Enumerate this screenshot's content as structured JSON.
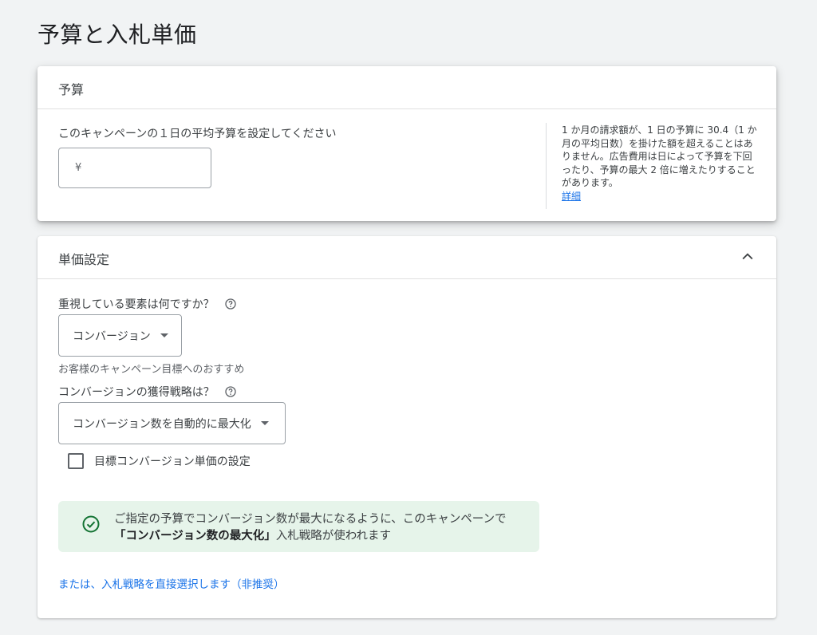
{
  "page": {
    "title": "予算と入札単価"
  },
  "budget": {
    "header": "予算",
    "question": "このキャンペーンの１日の平均予算を設定してください",
    "currency_symbol": "¥",
    "value": "",
    "help_text": "1 か月の請求額が、1 日の予算に 30.4（1 か月の平均日数）を掛けた額を超えることはありません。広告費用は日によって予算を下回ったり、予算の最大 2 倍に増えたりすることがあります。",
    "help_link": "詳細"
  },
  "bidding": {
    "header": "単価設定",
    "collapse_icon": "chevron-up-icon",
    "focus_label": "重視している要素は何ですか？",
    "focus_value": "コンバージョン",
    "focus_hint": "お客様のキャンペーン目標へのおすすめ",
    "strategy_label": "コンバージョンの獲得戦略は？",
    "strategy_value": "コンバージョン数を自動的に最大化",
    "target_cpa_label": "目標コンバージョン単価の設定",
    "banner_prefix": "ご指定の予算でコンバージョン数が最大になるように、このキャンペーンで",
    "banner_bold": "「コンバージョン数の最大化」",
    "banner_suffix": "入札戦略が使われます",
    "manual_link": "または、入札戦略を直接選択します（非推奨）"
  },
  "colors": {
    "accent": "#1a73e8",
    "success": "#137333",
    "banner_bg": "#e6f4ea"
  }
}
